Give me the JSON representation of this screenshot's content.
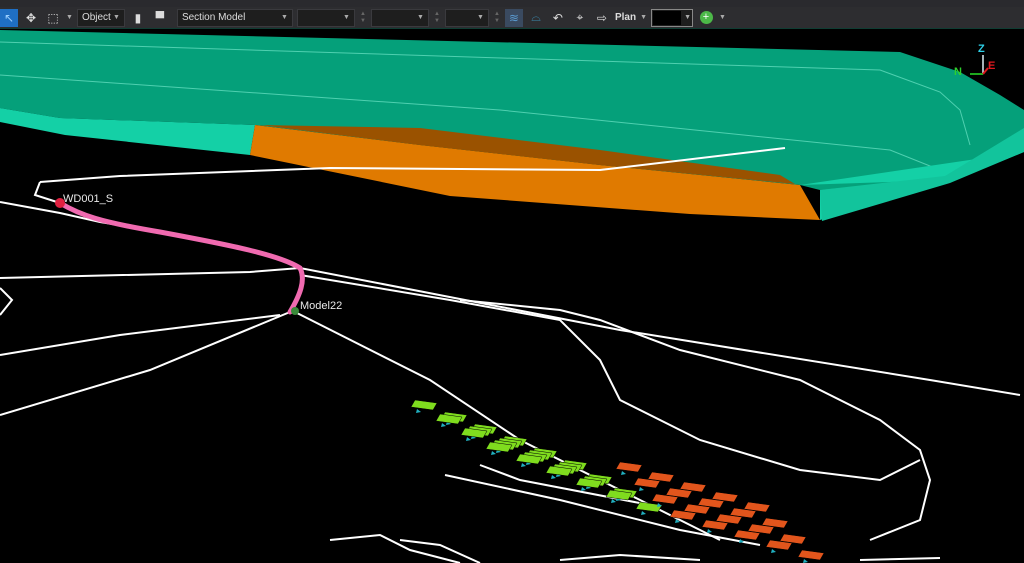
{
  "toolbar": {
    "select_mode": "Object",
    "model_select": "Section Model",
    "field1": "",
    "field2": "",
    "field3": "",
    "view_label": "Plan",
    "color_swatch": "#000000",
    "icons": [
      "select-arrow-icon",
      "move-icon",
      "marquee-select-icon",
      "pen-icon",
      "display-icon",
      "section-icon",
      "visibility-icon",
      "rotate-icon",
      "target-icon",
      "view-direction-icon",
      "add-icon"
    ]
  },
  "axes": {
    "z": "Z",
    "n": "N",
    "e": "E"
  },
  "labels": {
    "well": "WD001_S",
    "model": "Model22"
  },
  "colors": {
    "surface": "#05a07a",
    "surface_edge": "#12d4a8",
    "orange_band": "#e07a00",
    "well_path": "#f06ab0",
    "block_green": "#7fdc1e",
    "block_orange": "#e2551c",
    "accent": "#1f6fc4"
  }
}
